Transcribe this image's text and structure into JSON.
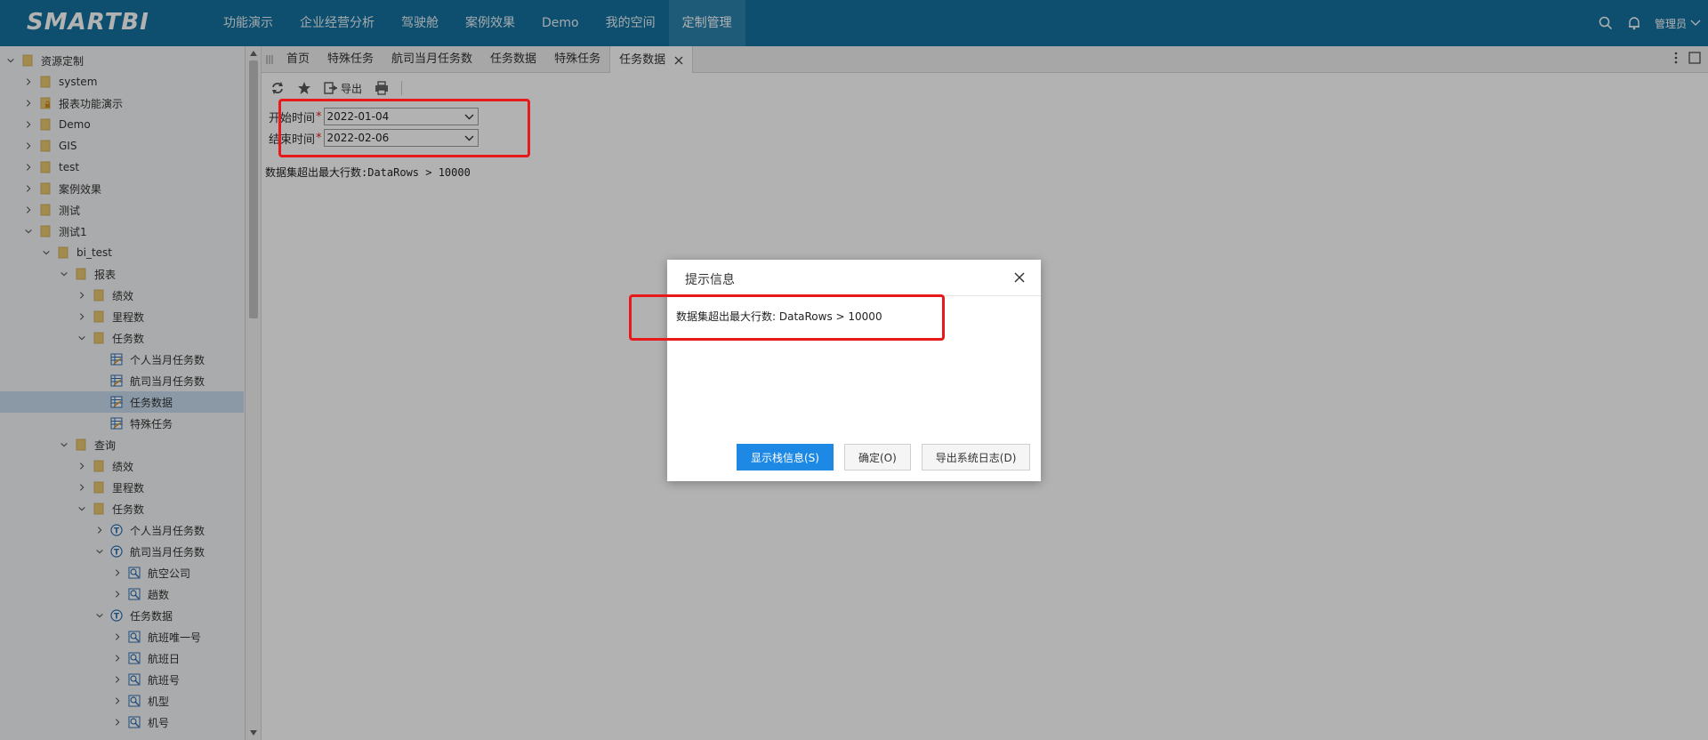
{
  "app": {
    "logo_text": "SMARTBI"
  },
  "nav": {
    "items": [
      {
        "label": "功能演示"
      },
      {
        "label": "企业经营分析"
      },
      {
        "label": "驾驶舱"
      },
      {
        "label": "案例效果"
      },
      {
        "label": "Demo"
      },
      {
        "label": "我的空间"
      },
      {
        "label": "定制管理",
        "active": true
      }
    ]
  },
  "topright": {
    "user_label": "管理员"
  },
  "tree": {
    "items": [
      {
        "label": "资源定制",
        "icon": "folder-icon",
        "toggle": "expanded"
      },
      {
        "label": "system",
        "icon": "folder-icon",
        "toggle": "collapsed"
      },
      {
        "label": "报表功能演示",
        "icon": "locked-folder-icon",
        "toggle": "collapsed"
      },
      {
        "label": "Demo",
        "icon": "folder-icon",
        "toggle": "collapsed"
      },
      {
        "label": "GIS",
        "icon": "folder-icon",
        "toggle": "collapsed"
      },
      {
        "label": "test",
        "icon": "folder-icon",
        "toggle": "collapsed"
      },
      {
        "label": "案例效果",
        "icon": "folder-icon",
        "toggle": "collapsed"
      },
      {
        "label": "测试",
        "icon": "folder-icon",
        "toggle": "collapsed"
      },
      {
        "label": "测试1",
        "icon": "folder-icon",
        "toggle": "expanded"
      },
      {
        "label": "bi_test",
        "icon": "folder-icon",
        "toggle": "expanded"
      },
      {
        "label": "报表",
        "icon": "folder-icon",
        "toggle": "expanded"
      },
      {
        "label": "绩效",
        "icon": "folder-icon",
        "toggle": "collapsed"
      },
      {
        "label": "里程数",
        "icon": "folder-icon",
        "toggle": "collapsed"
      },
      {
        "label": "任务数",
        "icon": "folder-icon",
        "toggle": "expanded"
      },
      {
        "label": "个人当月任务数",
        "icon": "report-icon",
        "toggle": "none"
      },
      {
        "label": "航司当月任务数",
        "icon": "report-icon",
        "toggle": "none"
      },
      {
        "label": "任务数据",
        "icon": "report-icon",
        "toggle": "none",
        "selected": true
      },
      {
        "label": "特殊任务",
        "icon": "report-icon",
        "toggle": "none"
      },
      {
        "label": "查询",
        "icon": "folder-icon",
        "toggle": "expanded"
      },
      {
        "label": "绩效",
        "icon": "folder-icon",
        "toggle": "collapsed"
      },
      {
        "label": "里程数",
        "icon": "folder-icon",
        "toggle": "collapsed"
      },
      {
        "label": "任务数",
        "icon": "folder-icon",
        "toggle": "expanded"
      },
      {
        "label": "个人当月任务数",
        "icon": "query-icon",
        "toggle": "collapsed"
      },
      {
        "label": "航司当月任务数",
        "icon": "query-icon",
        "toggle": "expanded"
      },
      {
        "label": "航空公司",
        "icon": "field-icon",
        "toggle": "collapsed"
      },
      {
        "label": "趟数",
        "icon": "field-icon",
        "toggle": "collapsed"
      },
      {
        "label": "任务数据",
        "icon": "query-icon",
        "toggle": "expanded"
      },
      {
        "label": "航班唯一号",
        "icon": "field-icon",
        "toggle": "collapsed"
      },
      {
        "label": "航班日",
        "icon": "field-icon",
        "toggle": "collapsed"
      },
      {
        "label": "航班号",
        "icon": "field-icon",
        "toggle": "collapsed"
      },
      {
        "label": "机型",
        "icon": "field-icon",
        "toggle": "collapsed"
      },
      {
        "label": "机号",
        "icon": "field-icon",
        "toggle": "collapsed"
      }
    ]
  },
  "tabs": {
    "items": [
      {
        "label": "首页"
      },
      {
        "label": "特殊任务"
      },
      {
        "label": "航司当月任务数"
      },
      {
        "label": "任务数据"
      },
      {
        "label": "特殊任务"
      },
      {
        "label": "任务数据",
        "active": true,
        "closable": true
      }
    ]
  },
  "toolbar": {
    "export_label": "导出"
  },
  "params": {
    "start": {
      "label": "开始时间",
      "required_mark": "*",
      "value": "2022-01-04"
    },
    "end": {
      "label": "结束时间",
      "required_mark": "*",
      "value": "2022-02-06"
    }
  },
  "report": {
    "error_text": "数据集超出最大行数:DataRows > 10000"
  },
  "dialog": {
    "title": "提示信息",
    "message": "数据集超出最大行数: DataRows > 10000",
    "buttons": {
      "show_stack": "显示栈信息(S)",
      "ok": "确定(O)",
      "export_log": "导出系统日志(D)"
    }
  },
  "colors": {
    "topbar": "#15729f",
    "primary_button": "#1e88e5",
    "highlight_box": "#e8191b",
    "selected_row": "#c8dcee",
    "folder": "#e8c872"
  }
}
